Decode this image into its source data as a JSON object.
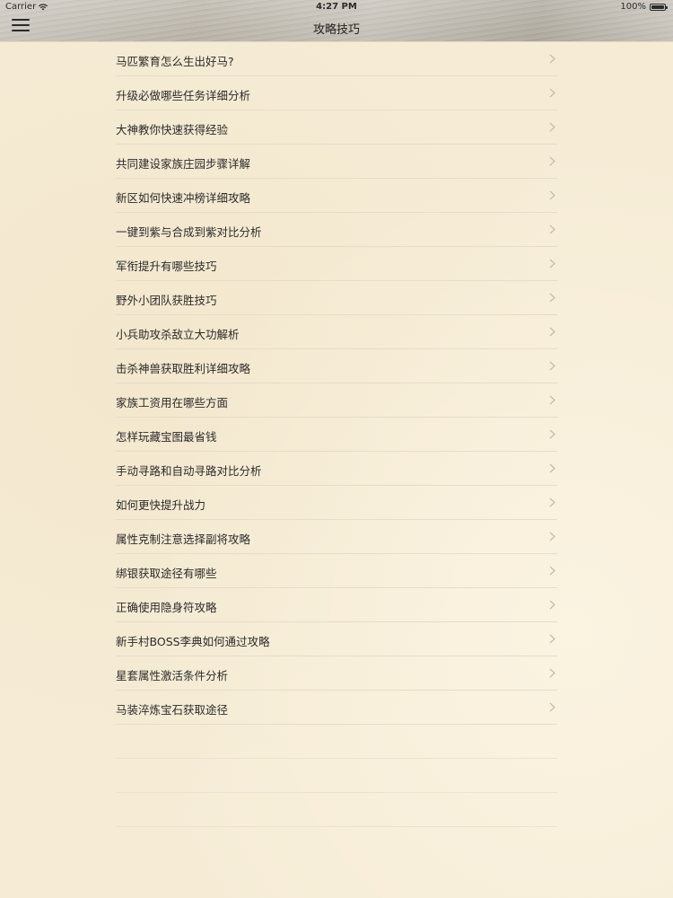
{
  "status_bar": {
    "carrier": "Carrier",
    "time": "4:27 PM",
    "battery": "100%",
    "icons": [
      "wifi-icon",
      "battery-icon"
    ]
  },
  "nav": {
    "title": "攻略技巧",
    "menu_icon": "hamburger-menu-icon"
  },
  "list": {
    "items": [
      {
        "label": "马匹繁育怎么生出好马?"
      },
      {
        "label": "升级必做哪些任务详细分析"
      },
      {
        "label": "大神教你快速获得经验"
      },
      {
        "label": "共同建设家族庄园步骤详解"
      },
      {
        "label": "新区如何快速冲榜详细攻略"
      },
      {
        "label": "一键到紫与合成到紫对比分析"
      },
      {
        "label": "军衔提升有哪些技巧"
      },
      {
        "label": "野外小团队获胜技巧"
      },
      {
        "label": "小兵助攻杀敌立大功解析"
      },
      {
        "label": "击杀神兽获取胜利详细攻略"
      },
      {
        "label": "家族工资用在哪些方面"
      },
      {
        "label": "怎样玩藏宝图最省钱"
      },
      {
        "label": "手动寻路和自动寻路对比分析"
      },
      {
        "label": "如何更快提升战力"
      },
      {
        "label": "属性克制注意选择副将攻略"
      },
      {
        "label": "绑银获取途径有哪些"
      },
      {
        "label": "正确使用隐身符攻略"
      },
      {
        "label": "新手村BOSS李典如何通过攻略"
      },
      {
        "label": "星套属性激活条件分析"
      },
      {
        "label": "马装淬炼宝石获取途径"
      }
    ],
    "row_icon": "chevron-right-icon"
  }
}
